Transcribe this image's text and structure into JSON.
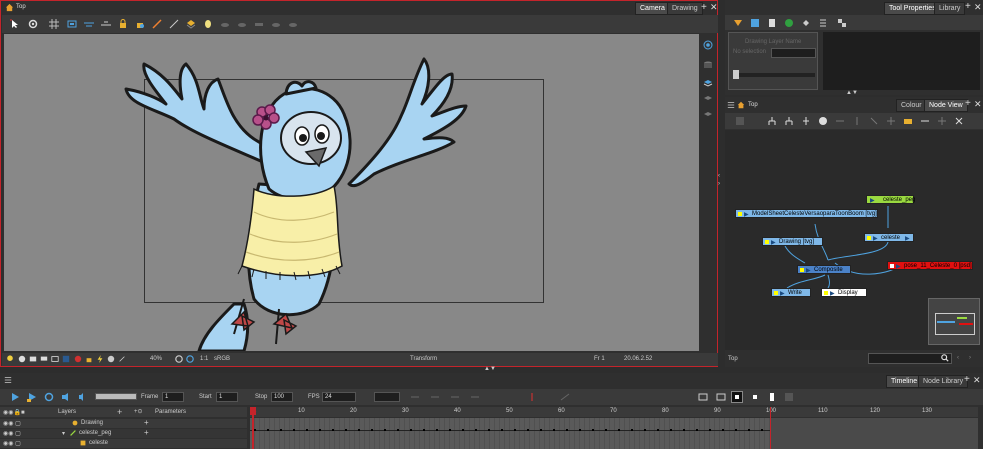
{
  "colors": {
    "accent_red": "#c4242b",
    "peg_green": "#9ad940",
    "drawing_blue": "#7fb8e8",
    "composite_blue": "#4b82c8",
    "red_node": "#e01010",
    "bird_blue": "#a8d4f2",
    "scarf": "#f8efa8",
    "stage": "#888888"
  },
  "camera_view": {
    "breadcrumb": "Top",
    "tabs": [
      "Camera",
      "Drawing"
    ],
    "status": {
      "zoom": "40%",
      "rotation": "1:1",
      "color_space": "sRGB",
      "mode": "Transform",
      "frame": "Fr 1",
      "coords": "20.06.2.52"
    }
  },
  "tool_properties": {
    "tabs": [
      "Tool Properties",
      "Library"
    ],
    "labels": [
      "Drawing Layer Name",
      "No selection"
    ]
  },
  "node_view": {
    "breadcrumb": "Top",
    "tabs": [
      "Colour",
      "Node View"
    ],
    "path": "Top",
    "nodes": {
      "peg": "celeste_peg",
      "model": "ModelSheetCelesteVersaoparaToonBoom  [tvg]",
      "drawing": "Drawing  [tvg]",
      "celeste": "celeste",
      "composite": "Composite",
      "red": "pose_11_Celeste_0  [psd]",
      "write": "Write",
      "display": "Display"
    }
  },
  "timeline": {
    "tabs": [
      "Timeline",
      "Node Library"
    ],
    "frame_label": "Frame",
    "frame_value": "1",
    "start_label": "Start",
    "start_value": "1",
    "stop_label": "Stop",
    "stop_value": "100",
    "fps_label": "FPS",
    "fps_value": "24",
    "layers_header": "Layers",
    "params_header": "Parameters",
    "layers": [
      "Drawing",
      "celeste_peg",
      "celeste"
    ],
    "ruler": [
      "1",
      "10",
      "20",
      "30",
      "40",
      "50",
      "60",
      "70",
      "80",
      "90",
      "100",
      "110",
      "120",
      "130"
    ]
  }
}
